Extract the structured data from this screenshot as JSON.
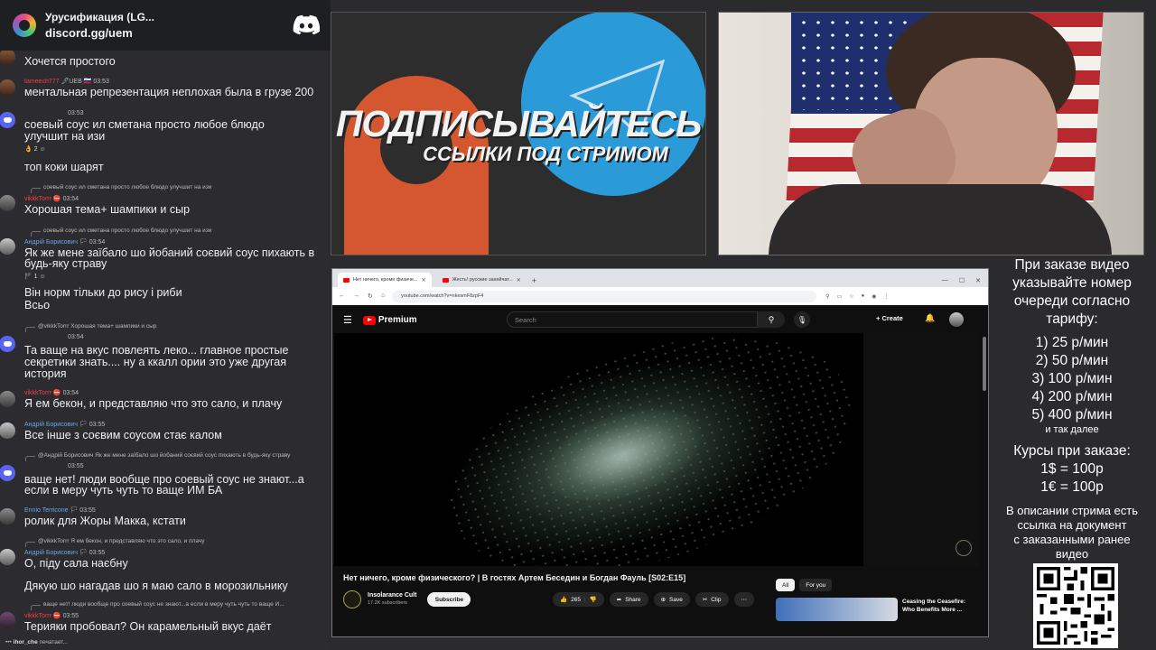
{
  "discord": {
    "server_name": "Урусификация (LG...",
    "invite": "discord.gg/uem",
    "typing": {
      "user": "ihor_che",
      "text": "печатает..."
    },
    "messages": [
      {
        "type": "text",
        "text": "Хочется простого"
      },
      {
        "type": "meta",
        "user": "tameech777",
        "tags": "🖋UEB 🇷🇺",
        "time": "03:53"
      },
      {
        "type": "text",
        "text": "ментальная репрезентация неплохая была в грузе 200"
      },
      {
        "type": "meta",
        "user": "",
        "tags": "",
        "time": "03:53"
      },
      {
        "type": "text",
        "text": "соевый соус ил сметана просто любое блюдо"
      },
      {
        "type": "text",
        "text": "улучшит на изи"
      },
      {
        "type": "react",
        "text": "2"
      },
      {
        "type": "text",
        "text": "топ коки шарят"
      },
      {
        "type": "reply",
        "text": "соевый соус ил сметана просто любое блюдо улучшит на изи"
      },
      {
        "type": "meta",
        "user": "vikkkTorrr",
        "tags": "",
        "time": "03:54"
      },
      {
        "type": "text",
        "text": "Хорошая тема+ шампики и сыр"
      },
      {
        "type": "reply",
        "text": "соевый соус ил сметана просто любое блюдо улучшит на изи"
      },
      {
        "type": "meta",
        "user": "Андрій Борисович",
        "tags": "",
        "time": "03:54"
      },
      {
        "type": "text",
        "text": "Як же мене заїбало шо йобаний соєвий соус пихають в"
      },
      {
        "type": "text",
        "text": "будь-яку страву"
      },
      {
        "type": "react",
        "text": "1"
      },
      {
        "type": "text",
        "text": "Він норм тільки до рису і риби"
      },
      {
        "type": "text",
        "text": "Всьо"
      },
      {
        "type": "reply",
        "text": "@vikkkTorrr Хорошая тема+ шампики и сыр"
      },
      {
        "type": "meta",
        "user": "",
        "tags": "",
        "time": "03:54"
      },
      {
        "type": "text",
        "text": "Та ваще на вкус повлеять леко... главное простые"
      },
      {
        "type": "text",
        "text": "секретики знать.... ну а ккалл ории это уже другая"
      },
      {
        "type": "text",
        "text": "история"
      },
      {
        "type": "meta",
        "user": "vikkkTorrr",
        "tags": "",
        "time": "03:54"
      },
      {
        "type": "text",
        "text": "Я ем бекон, и представляю что это сало, и плачу"
      },
      {
        "type": "meta",
        "user": "Андрій Борисович",
        "tags": "",
        "time": "03:55"
      },
      {
        "type": "text",
        "text": "Все інше з соєвим соусом стає калом"
      },
      {
        "type": "reply",
        "text": "@Андрій Борисович Як же мене заїбало шо йобаний соєвий соус пихають в будь-яку страву"
      },
      {
        "type": "meta",
        "user": "",
        "tags": "",
        "time": "03:55"
      },
      {
        "type": "text",
        "text": "ваще нет! люди вообще про соевый соус не знают...а"
      },
      {
        "type": "text",
        "text": "если в меру чуть чуть то ваще ИМ БА"
      },
      {
        "type": "meta",
        "user": "Ennio Terricone",
        "tags": "",
        "time": "03:55"
      },
      {
        "type": "text",
        "text": "ролик для Жоры Макка, кстати"
      },
      {
        "type": "reply",
        "text": "@vikkkTorrr Я ем бекон, и представляю что это сало, и плачу"
      },
      {
        "type": "meta",
        "user": "Андрій Борисович",
        "tags": "",
        "time": "03:55"
      },
      {
        "type": "text",
        "text": "О, піду сала наєбну"
      },
      {
        "type": "text",
        "text": "Дякую шо нагадав шо я маю сало в морозильнику"
      },
      {
        "type": "reply",
        "text": "ваще нет! люди вообще про соевый соус не знают...а если в меру чуть чуть то ваще И..."
      },
      {
        "type": "meta",
        "user": "vikkkTorrr",
        "tags": "",
        "time": "03:55"
      },
      {
        "type": "text",
        "text": "Терияки пробовал? Он карамельный вкус даёт"
      }
    ]
  },
  "promo": {
    "headline": "ПОДПИСЫВАЙТЕСЬ",
    "subline": "ССЫЛКИ ПОД СТРИМОМ"
  },
  "browser": {
    "tab1": "Нет ничего, кроме физиче...",
    "tab2": "Жесть! русские захейчат...",
    "url": "youtube.com/watch?v=nkesmF8zpF4",
    "yt_logo": "Premium",
    "search_placeholder": "Search",
    "create_label": "Create",
    "video_title": "Нет ничего, кроме физического? | В гостях Артем Беседин и Богдан Фауль [S02:E15]",
    "channel": "Insolarance Cult",
    "subscribers": "17.2K subscribers",
    "subscribe_label": "Subscribe",
    "likes": "265",
    "share_label": "Share",
    "save_label": "Save",
    "clip_label": "Clip",
    "chips": [
      "All",
      "For you"
    ],
    "rec_title": "Ceasing the Ceasefire: Who Benefits More ..."
  },
  "info": {
    "intro": [
      "При заказе видео",
      "указывайте номер",
      "очереди согласно",
      "тарифу:"
    ],
    "tariffs": [
      "1) 25 р/мин",
      "2) 50 р/мин",
      "3) 100 р/мин",
      "4) 200 р/мин",
      "5) 400 р/мин"
    ],
    "etc": "и так далее",
    "rates_title": "Курсы при заказе:",
    "rates": [
      "1$ = 100р",
      "1€ = 100р"
    ],
    "footer": [
      "В описании стрима есть",
      "ссылка на документ",
      "с заказанными ранее",
      "видео"
    ]
  }
}
